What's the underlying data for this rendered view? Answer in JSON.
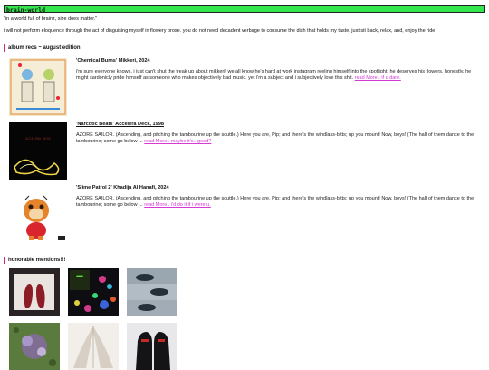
{
  "header": {
    "title": "brain-world"
  },
  "tagline": "\"in a world full of brainz, size does matter.\"",
  "intro": "i will not perform eloquence through the act of disguising myself in flowery prose. you do not need decadent verbage to consume the dish that holds my taste. just sit back, relax, and, enjoy the ride",
  "album_section": {
    "heading": "album recs ~ august edition",
    "items": [
      {
        "title": "'Chemical Burns' Mikkeri, 2024",
        "body": "i'm sure everyone knows, i just can't shut the freak up about mikkeri! we all know he's hard at work instagram reeling himself into the spotlight. he deserves his flowers, honestly. he might sardonicly pride himself as someone who makes objectively bad music. yet i'm a subject and i subjectively love this shit.",
        "more": "read More.. if u dare."
      },
      {
        "title": "'Narcotic Beats' Accelera Deck, 1998",
        "body": "AZORE SAILOR. (Ascending, and pitching the tambourine up the scuttle.) Here you are, Pip; and there's the windlass-bitts; up you mount! Now, boys! (The half of them dance to the tambourine; some go below ...",
        "more": "read More.. maybe it's.. good?"
      },
      {
        "title": "'Slime Patrol 2' Khadija Al Hanafi, 2024",
        "body": "AZORE SAILOR. (Ascending, and pitching the tambourine up the scuttle.) Here you are, Pip; and there's the windlass-bitts; up you mount! Now, boys! (The half of them dance to the tambourine; some go below ...",
        "more": "read More.. i'd do it if i were u."
      }
    ]
  },
  "mentions_section": {
    "heading": "honorable mentions!!!"
  }
}
